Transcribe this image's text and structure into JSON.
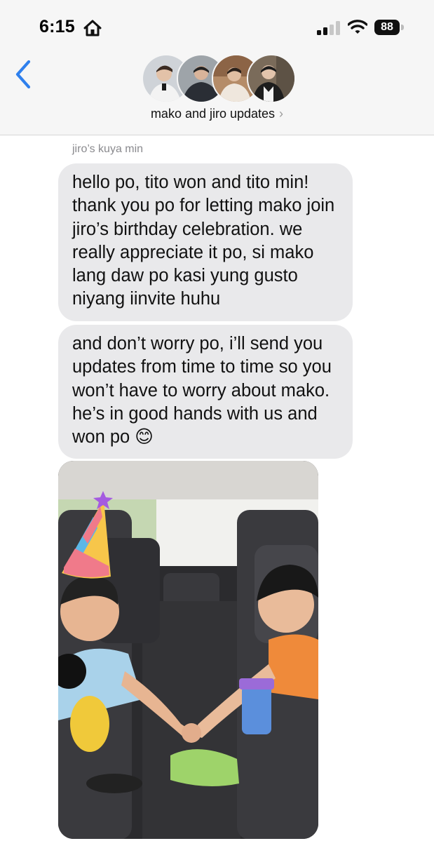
{
  "status_bar": {
    "time": "6:15",
    "battery": "88",
    "icons": [
      "home-icon",
      "signal-icon",
      "wifi-icon",
      "battery-icon"
    ]
  },
  "header": {
    "back_icon": "chevron-left-icon",
    "group_name": "mako and jiro updates",
    "chevron": "›",
    "accent_color": "#2f80ed"
  },
  "messages": [
    {
      "sender": "jiro’s kuya min",
      "text": "hello po, tito won and tito min! thank you po for letting mako join jiro’s birthday celebration. we really appreciate it po, si mako lang daw po kasi yung gusto niyang iinvite huhu"
    },
    {
      "text": "and don’t worry po, i’ll send you updates from time to time so you won’t have to worry about mako. he’s in good hands with us and won po 😊"
    },
    {
      "type": "photo",
      "description": "two kids in car seats holding hands, party hat sticker"
    }
  ],
  "colors": {
    "bubble": "#e9e9eb",
    "background": "#ffffff",
    "bar": "#f6f6f6"
  }
}
